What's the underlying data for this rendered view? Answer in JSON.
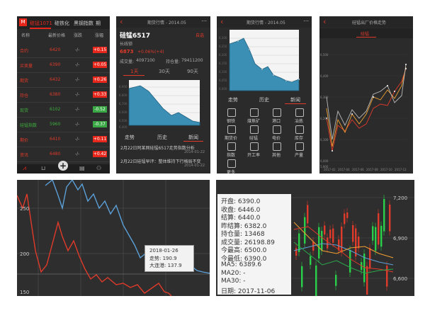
{
  "p1": {
    "logo": "M",
    "tabs": [
      "硅锰1071",
      "硅铁化",
      "黑钢指数",
      "期"
    ],
    "cols": [
      "名称",
      "最新价格",
      "涨跌",
      "涨幅"
    ],
    "rows": [
      {
        "name": "合约",
        "price": "6420",
        "chg": "-/-",
        "badge": "+0.15",
        "color": "red"
      },
      {
        "name": "买卖量",
        "price": "6390",
        "chg": "-/-",
        "badge": "+0.05",
        "color": "red"
      },
      {
        "name": "期货",
        "price": "6432",
        "chg": "-/-",
        "badge": "+0.26",
        "color": "red"
      },
      {
        "name": "持仓",
        "price": "6380",
        "chg": "-/-",
        "badge": "+0.33",
        "color": "red"
      },
      {
        "name": "现货",
        "price": "6102",
        "chg": "-/-",
        "badge": "-0.52",
        "color": "green"
      },
      {
        "name": "硅锰指数",
        "price": "5960",
        "chg": "-/-",
        "badge": "-0.37",
        "color": "green"
      },
      {
        "name": "期价",
        "price": "6410",
        "chg": "-/-",
        "badge": "+0.11",
        "color": "red"
      },
      {
        "name": "资讯",
        "price": "6480",
        "chg": "-/-",
        "badge": "+0.42",
        "color": "red"
      }
    ],
    "nav": [
      "+"
    ]
  },
  "p2": {
    "header_title": "期货行情 - 2014.05",
    "title": "硅锰6517",
    "sub": "长线锁",
    "price": "6873",
    "change": "+0.06%(+4)",
    "right_tag": "自选",
    "vol_label": "成交量:",
    "vol_value": "4097100",
    "pos_label": "持仓量:",
    "pos_value": "79411200",
    "tabs": [
      "1天",
      "30天",
      "90天"
    ],
    "ylabels": [
      "6,900",
      "6,800",
      "6,700",
      "6,600",
      "6,500",
      "6,400"
    ],
    "bottom_tabs": [
      "走势",
      "历史",
      "新闻"
    ],
    "news": [
      {
        "text": "2月22日阿某网硅锰6517走势指数分析",
        "date": "2014-01-22"
      },
      {
        "text": "2月22日硅锰早评：整体维持下行格局不变",
        "date": "2014-01-22"
      }
    ]
  },
  "p3": {
    "header_title": "期货行情 - 2014.05",
    "ylabels": [
      "6,300",
      "6,250",
      "6,200",
      "6,150",
      "6,100",
      "6,050",
      "6,000"
    ],
    "tabs": [
      "走势",
      "历史",
      "新闻"
    ],
    "grid": [
      {
        "icon": "bars-icon",
        "label": "钢铁"
      },
      {
        "icon": "factory-icon",
        "label": "煤焦矿"
      },
      {
        "icon": "anchor-icon",
        "label": "港口"
      },
      {
        "icon": "lightning-icon",
        "label": "冶炼"
      },
      {
        "icon": "truck-icon",
        "label": "期货价"
      },
      {
        "icon": "circle-icon",
        "label": "硅锰"
      },
      {
        "icon": "plug-icon",
        "label": "电价"
      },
      {
        "icon": "layers-icon",
        "label": "库存"
      },
      {
        "icon": "gear-icon",
        "label": "指数"
      },
      {
        "icon": "ruler-icon",
        "label": "开工率"
      },
      {
        "icon": "bottle-icon",
        "label": "其他"
      },
      {
        "icon": "tool-icon",
        "label": "产量"
      },
      {
        "icon": "card-icon",
        "label": "更多"
      }
    ]
  },
  "p4": {
    "header_title": "硅锰出厂价格走势",
    "tab": "硅锰",
    "ylabels": [
      "6,500",
      "6,400",
      "6,300",
      "6,200",
      "6,100",
      "6,000",
      "5,900"
    ],
    "xlabels": [
      "2017-02",
      "2017-04",
      "2017-06",
      "2017-08",
      "2017-10",
      "2017-12"
    ]
  },
  "p5": {
    "ylabels": [
      "250",
      "200",
      "150"
    ],
    "tooltip": {
      "date": "2018-01-26",
      "line1": "走势: 190.9",
      "line2": "大连港: 137.9"
    }
  },
  "p6": {
    "ylabels": [
      "7,200",
      "6,900",
      "6,600"
    ],
    "info": [
      {
        "k": "开盘:",
        "v": "6390.0"
      },
      {
        "k": "收盘:",
        "v": "6446.0"
      },
      {
        "k": "结算:",
        "v": "6440.0"
      },
      {
        "k": "昨结算:",
        "v": "6382.0"
      },
      {
        "k": "持仓量:",
        "v": "13468"
      },
      {
        "k": "成交量:",
        "v": "26198.89"
      },
      {
        "k": "今最高:",
        "v": "6500.0"
      },
      {
        "k": "今最低:",
        "v": "6390.0"
      },
      {
        "k": "MA5:",
        "v": "6389.6"
      },
      {
        "k": "MA20:",
        "v": "-"
      },
      {
        "k": "MA30:",
        "v": "-"
      },
      {
        "k": "日期:",
        "v": "2017-11-06"
      }
    ]
  }
}
